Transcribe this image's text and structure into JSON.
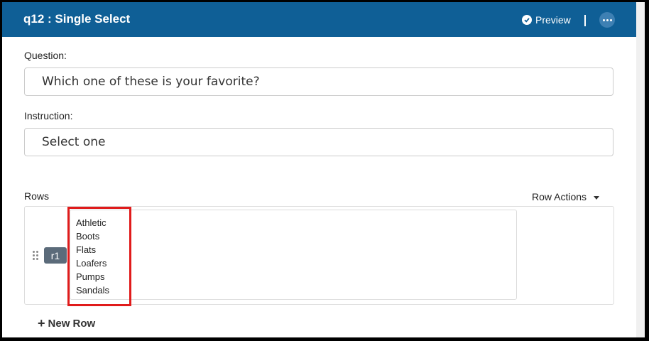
{
  "header": {
    "title": "q12 : Single Select",
    "preview_label": "Preview",
    "preview_icon": "check-circle-icon",
    "more_icon": "more-horizontal-icon",
    "background_color": "#0f5f96"
  },
  "question": {
    "label": "Question:",
    "value": "Which one of these is your favorite?"
  },
  "instruction": {
    "label": "Instruction:",
    "value": "Select one"
  },
  "rows": {
    "label": "Rows",
    "actions_label": "Row Actions",
    "items": [
      {
        "id": "r1",
        "options": [
          "Athletic",
          "Boots",
          "Flats",
          "Loafers",
          "Pumps",
          "Sandals"
        ]
      }
    ],
    "new_row_label": "New Row"
  },
  "highlight_color": "#e01b1b"
}
